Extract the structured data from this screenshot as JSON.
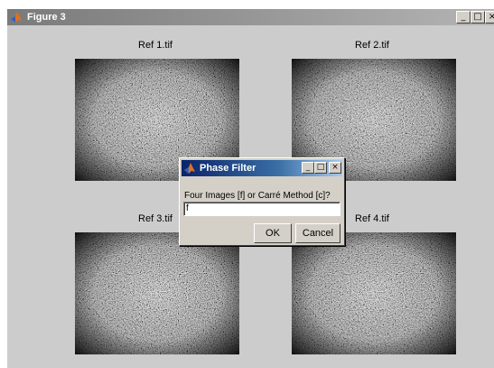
{
  "figure": {
    "title": "Figure 3",
    "min_glyph": "_",
    "max_glyph": "□",
    "close_glyph": "×",
    "axes": [
      {
        "title": "Ref 1.tif"
      },
      {
        "title": "Ref 2.tif"
      },
      {
        "title": "Ref 3.tif"
      },
      {
        "title": "Ref 4.tif"
      }
    ]
  },
  "dialog": {
    "title": "Phase Filter",
    "prompt": "Four Images [f] or Carré Method [c]?",
    "input_value": "f",
    "ok_label": "OK",
    "cancel_label": "Cancel",
    "min_glyph": "_",
    "max_glyph": "□",
    "close_glyph": "×"
  },
  "icons": {
    "app": "matlab-logo-icon"
  },
  "colors": {
    "figure_bg": "#cccccc",
    "active_title": "#0a246a",
    "inactive_title": "#808080"
  }
}
